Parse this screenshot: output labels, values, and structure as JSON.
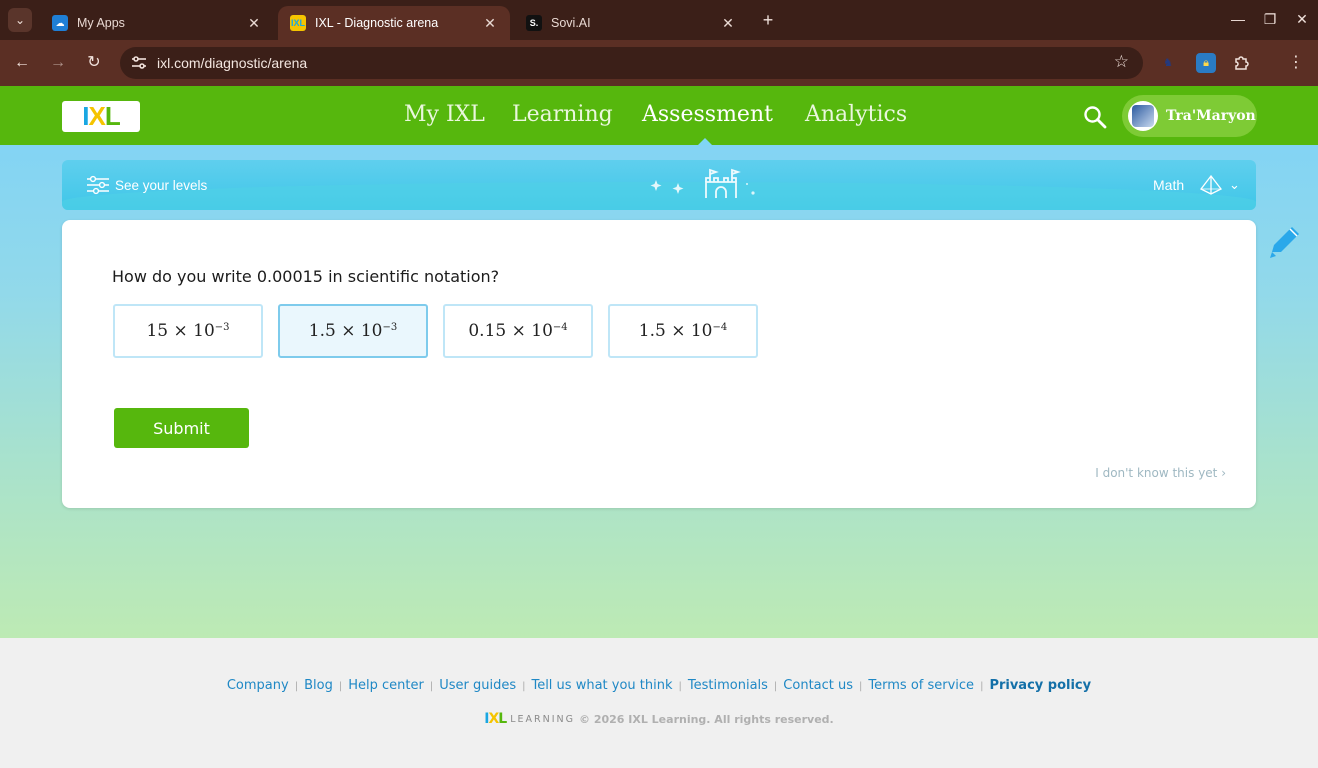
{
  "browser": {
    "tabs": [
      {
        "title": "My Apps",
        "active": false
      },
      {
        "title": "IXL - Diagnostic arena",
        "active": true
      },
      {
        "title": "Sovi.AI",
        "active": false
      }
    ],
    "url": "ixl.com/diagnostic/arena",
    "close_glyph": "✕",
    "new_tab_glyph": "+",
    "back_glyph": "←",
    "forward_glyph": "→",
    "reload_glyph": "↻",
    "star_glyph": "☆",
    "menu_glyph": "⋮"
  },
  "header": {
    "logo_letters": [
      "I",
      "X",
      "L"
    ],
    "nav": [
      {
        "label": "My IXL",
        "active": false
      },
      {
        "label": "Learning",
        "active": false
      },
      {
        "label": "Assessment",
        "active": true
      },
      {
        "label": "Analytics",
        "active": false
      }
    ],
    "user_name": "Tra'Maryon"
  },
  "level_bar": {
    "levels_label": "See your levels",
    "subject": "Math"
  },
  "question": {
    "prompt": "How do you write 0.00015 in scientific notation?",
    "choices": [
      {
        "coef": "15",
        "times": "×",
        "base": "10",
        "exp": "−3",
        "selected": false
      },
      {
        "coef": "1.5",
        "times": "×",
        "base": "10",
        "exp": "−3",
        "selected": true
      },
      {
        "coef": "0.15",
        "times": "×",
        "base": "10",
        "exp": "−4",
        "selected": false
      },
      {
        "coef": "1.5",
        "times": "×",
        "base": "10",
        "exp": "−4",
        "selected": false
      }
    ],
    "submit_label": "Submit",
    "dont_know_label": "I don't know this yet ›"
  },
  "footer": {
    "links": [
      "Company",
      "Blog",
      "Help center",
      "User guides",
      "Tell us what you think",
      "Testimonials",
      "Contact us",
      "Terms of service",
      "Privacy policy"
    ],
    "separator": "|",
    "logo_letters": [
      "I",
      "X",
      "L"
    ],
    "learning_word": "LEARNING",
    "copyright": "© 2026 IXL Learning. All rights reserved."
  },
  "colors": {
    "ixl_green": "#56b70d",
    "ixl_blue": "#1aa7e2",
    "ixl_yellow": "#f5c400",
    "chrome_dark": "#3b1f18",
    "chrome_toolbar": "#5b2f24",
    "link_blue": "#1f88c5"
  },
  "icons": {
    "tab_search": "chevron-down-icon",
    "site_info": "tune-icon",
    "bookmark": "star-icon",
    "extensions": "puzzle-icon",
    "ixl_search": "search-icon",
    "levels": "sliders-icon",
    "arena": "castle-icon",
    "subject": "pyramid-icon",
    "edit": "pencil-icon"
  }
}
